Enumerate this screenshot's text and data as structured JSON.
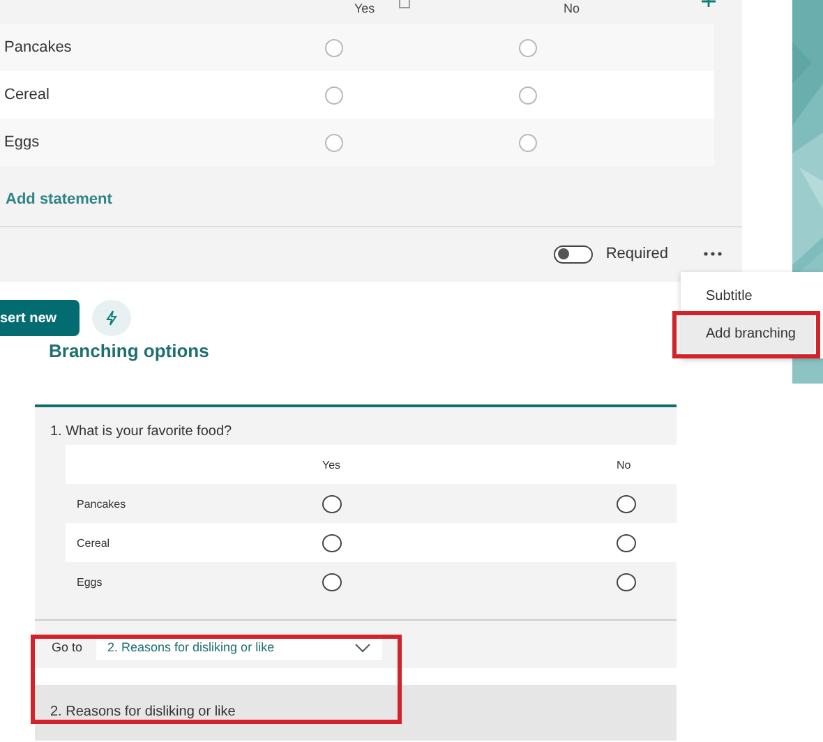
{
  "editor": {
    "columns": [
      "Yes",
      "No"
    ],
    "rows": [
      {
        "statement": "Pancakes",
        "options": [
          {
            "selected": false
          },
          {
            "selected": false
          }
        ]
      },
      {
        "statement": "Cereal",
        "options": [
          {
            "selected": false
          },
          {
            "selected": false
          }
        ]
      },
      {
        "statement": "Eggs",
        "options": [
          {
            "selected": false
          },
          {
            "selected": false
          }
        ]
      }
    ],
    "add_statement": "Add statement",
    "required": {
      "label": "Required",
      "on": false
    }
  },
  "menu": {
    "items": [
      {
        "label": "Subtitle",
        "hovered": false,
        "callout": false
      },
      {
        "label": "Add branching",
        "hovered": true,
        "callout": true
      }
    ]
  },
  "insert_button": "sert new",
  "branching": {
    "title": "Branching options",
    "question": "1. What is your favorite food?",
    "columns": [
      "Yes",
      "No"
    ],
    "rows": [
      {
        "statement": "Pancakes",
        "options": [
          {
            "selected": false
          },
          {
            "selected": false
          }
        ]
      },
      {
        "statement": "Cereal",
        "options": [
          {
            "selected": false
          },
          {
            "selected": false
          }
        ]
      },
      {
        "statement": "Eggs",
        "options": [
          {
            "selected": false
          },
          {
            "selected": false
          }
        ]
      }
    ],
    "goto": {
      "label": "Go to",
      "value": "2. Reasons for disliking or like",
      "callout": true
    },
    "next_section": "2. Reasons for disliking or like"
  }
}
